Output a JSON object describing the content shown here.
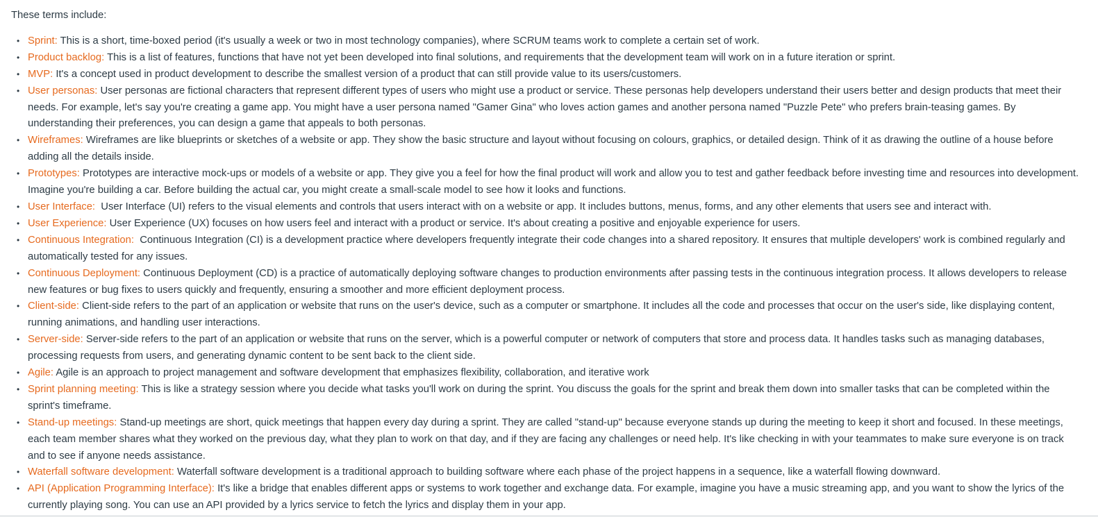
{
  "intro": "These terms include:",
  "colors": {
    "term": "#e66a1f",
    "text": "#2d3b45",
    "rule": "#c7cdd1"
  },
  "bullet_icon": "•",
  "terms": [
    {
      "term": "Sprint:",
      "sep": " ",
      "definition": "This is a short, time-boxed period (it's usually a week or two in most technology companies), where SCRUM teams work to complete a certain set of work."
    },
    {
      "term": "Product backlog:",
      "sep": " ",
      "definition": "This is a list of features, functions that have not yet been developed into final solutions, and requirements that the development team will work on in a future iteration or sprint."
    },
    {
      "term": "MVP:",
      "sep": " ",
      "definition": "It's a concept used in product development to describe the smallest version of a product that can still provide value to its users/customers."
    },
    {
      "term": "User personas:",
      "sep": " ",
      "definition": "User personas are fictional characters that represent different types of users who might use a product or service. These personas help developers understand their users better and design products that meet their needs. For example, let's say you're creating a game app. You might have a user persona named \"Gamer Gina\" who loves action games and another persona named \"Puzzle Pete\" who prefers brain-teasing games. By understanding their preferences, you can design a game that appeals to both personas."
    },
    {
      "term": "Wireframes:",
      "sep": " ",
      "definition": "Wireframes are like blueprints or sketches of a website or app. They show the basic structure and layout without focusing on colours, graphics, or detailed design. Think of it as drawing the outline of a house before adding all the details inside."
    },
    {
      "term": "Prototypes:",
      "sep": " ",
      "definition": "Prototypes are interactive mock-ups or models of a website or app. They give you a feel for how the final product will work and allow you to test and gather feedback before investing time and resources into development. Imagine you're building a car. Before building the actual car, you might create a small-scale model to see how it looks and functions."
    },
    {
      "term": "User Interface:",
      "sep": "  ",
      "definition": "User Interface (UI) refers to the visual elements and controls that users interact with on a website or app. It includes buttons, menus, forms, and any other elements that users see and interact with."
    },
    {
      "term": "User Experience:",
      "sep": " ",
      "definition": "User Experience (UX) focuses on how users feel and interact with a product or service. It's about creating a positive and enjoyable experience for users."
    },
    {
      "term": "Continuous Integration:",
      "sep": "  ",
      "definition": "Continuous Integration (CI) is a development practice where developers frequently integrate their code changes into a shared repository. It ensures that multiple developers' work is combined regularly and automatically tested for any issues."
    },
    {
      "term": "Continuous Deployment:",
      "sep": " ",
      "definition": "Continuous Deployment (CD) is a practice of automatically deploying software changes to production environments after passing tests in the continuous integration process. It allows developers to release new features or bug fixes to users quickly and frequently, ensuring a smoother and more efficient deployment process."
    },
    {
      "term": "Client-side:",
      "sep": " ",
      "definition": "Client-side refers to the part of an application or website that runs on the user's device, such as a computer or smartphone. It includes all the code and processes that occur on the user's side, like displaying content, running animations, and handling user interactions."
    },
    {
      "term": "Server-side:",
      "sep": " ",
      "definition": "Server-side refers to the part of an application or website that runs on the server, which is a powerful computer or network of computers that store and process data. It handles tasks such as managing databases, processing requests from users, and generating dynamic content to be sent back to the client side."
    },
    {
      "term": "Agile:",
      "sep": " ",
      "definition": "Agile is an approach to project management and software development that emphasizes flexibility, collaboration, and iterative work"
    },
    {
      "term": "Sprint planning meeting:",
      "sep": " ",
      "definition": "This is like a strategy session where you decide what tasks you'll work on during the sprint. You discuss the goals for the sprint and break them down into smaller tasks that can be completed within the sprint's timeframe."
    },
    {
      "term": "Stand-up meetings:",
      "sep": " ",
      "definition": "Stand-up meetings are short, quick meetings that happen every day during a sprint. They are called \"stand-up\" because everyone stands up during the meeting to keep it short and focused. In these meetings, each team member shares what they worked on the previous day, what they plan to work on that day, and if they are facing any challenges or need help. It's like checking in with your teammates to make sure everyone is on track and to see if anyone needs assistance."
    },
    {
      "term": "Waterfall software development:",
      "sep": " ",
      "definition": "Waterfall software development is a traditional approach to building software where each phase of the project happens in a sequence, like a waterfall flowing downward."
    },
    {
      "term": "API (Application Programming Interface):",
      "sep": " ",
      "definition": "It's like a bridge that enables different apps or systems to work together and exchange data. For example, imagine you have a music streaming app, and you want to show the lyrics of the currently playing song. You can use an API provided by a lyrics service to fetch the lyrics and display them in your app."
    }
  ]
}
